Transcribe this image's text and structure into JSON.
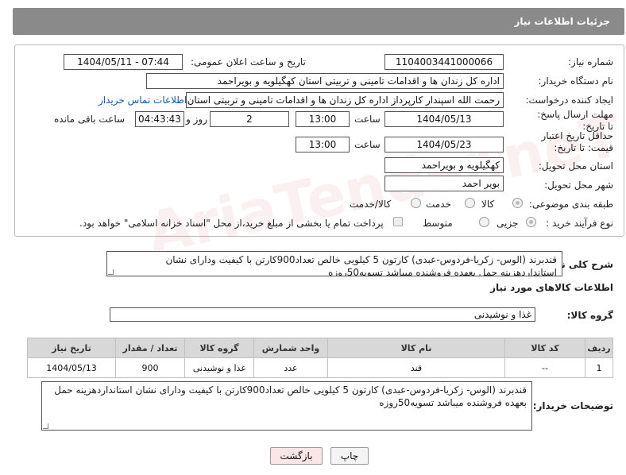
{
  "header": {
    "title": "جزئیات اطلاعات نیاز"
  },
  "form": {
    "need_number_label": "شماره نیاز:",
    "need_number": "1104003441000066",
    "announce_label": "تاریخ و ساعت اعلان عمومی:",
    "announce_value": "1404/05/11 - 07:44",
    "buyer_org_label": "نام دستگاه خریدار:",
    "buyer_org": "اداره کل زندان ها و اقدامات تامینی و تربیتی استان کهگیلویه و بویراحمد",
    "requester_label": "ایجاد کننده درخواست:",
    "requester": "رحمت الله اسپندار کارپرداز اداره کل زندان ها و اقدامات تامینی و تربیتی استان کهگیلویه و بویراحمد",
    "contact_link": "اطلاعات تماس خریدار",
    "reply_deadline_label": "مهلت ارسال پاسخ: تا تاریخ:",
    "reply_date": "1404/05/13",
    "time_label": "ساعت",
    "reply_time": "13:00",
    "days_value": "2",
    "days_label": "روز و",
    "remaining_time": "04:43:43",
    "remaining_label": "ساعت باقی مانده",
    "price_validity_label": "حداقل تاریخ اعتبار قیمت: تا تاریخ:",
    "validity_date": "1404/05/23",
    "validity_time": "13:00",
    "delivery_province_label": "استان محل تحویل:",
    "delivery_province": "کهگیلویه و بویراحمد",
    "delivery_city_label": "شهر محل تحویل:",
    "delivery_city": "بویر احمد",
    "category_label": "طبقه بندی موضوعی:",
    "category_options": [
      "کالا",
      "خدمت",
      "کالا/خدمت"
    ],
    "process_label": "نوع فرآیند خرید :",
    "process_options": [
      "جزیی",
      "متوسط"
    ],
    "payment_note": "پرداخت تمام یا بخشی از مبلغ خرید،از محل \"اسناد خزانه اسلامی\" خواهد بود."
  },
  "description": {
    "label": "شرح کلی نیاز:",
    "text": "قندبرند (الوس- زکریا-فردوس-عبدی) کارتون 5 کیلویی خالص تعداد900کارتن با کیفیت ودارای نشان استانداردهزینه حمل بعهده فروشنده میباشد   تسویه50روزه"
  },
  "goods": {
    "section_title": "اطلاعات کالاهای مورد نیاز",
    "group_label": "گروه کالا:",
    "group_value": "غذا و نوشیدنی",
    "columns": [
      "ردیف",
      "کد کالا",
      "نام کالا",
      "واحد شمارش",
      "گروه کالا",
      "تعداد / مقدار",
      "تاریخ نیاز"
    ],
    "rows": [
      [
        "1",
        "--",
        "قند",
        "عدد",
        "غذا و نوشیدنی",
        "900",
        "1404/05/13"
      ]
    ]
  },
  "buyer_notes": {
    "label": "توضیحات خریدار:",
    "text": "قندبرند (الوس- زکریا-فردوس-عبدی) کارتون 5 کیلویی خالص تعداد900کارتن با کیفیت ودارای نشان استانداردهزینه حمل بعهده فروشنده میباشد   تسویه50روزه"
  },
  "buttons": {
    "print": "چاپ",
    "back": "بازگشت"
  },
  "watermark": "AriaTender.neT"
}
